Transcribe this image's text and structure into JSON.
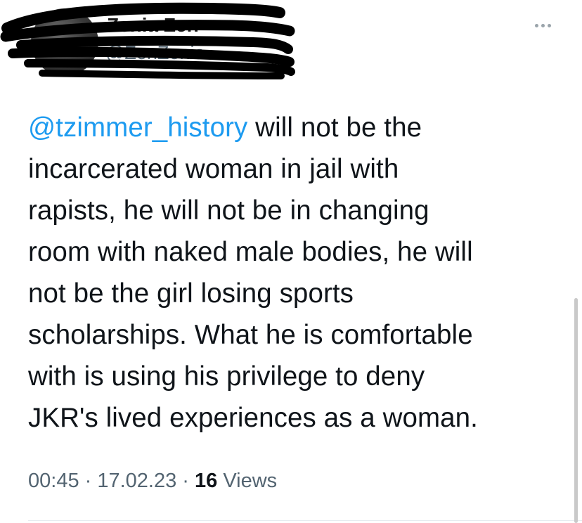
{
  "tweet": {
    "author": {
      "display_name": "Zenia Zen",
      "handle": "@ZenZenia"
    },
    "more_icon": "more-horizontal-icon",
    "text": {
      "mention": "@tzimmer_history",
      "line1_rest": " will not be the",
      "line2": "incarcerated woman in jail with",
      "line3": "rapists, he will not be in changing",
      "line4": "room with naked male bodies, he will",
      "line5": "not be the girl losing sports",
      "line6": "scholarships. What he is comfortable",
      "line7": "with is using his privilege to deny",
      "line8": "JKR's lived experiences as a woman."
    },
    "meta": {
      "time": "00:45",
      "sep1": " · ",
      "date": "17.02.23",
      "sep2": " · ",
      "views_count": "16",
      "views_label": " Views"
    }
  },
  "colors": {
    "mention": "#1d9bf0",
    "text": "#0f1419",
    "secondary": "#536471"
  }
}
